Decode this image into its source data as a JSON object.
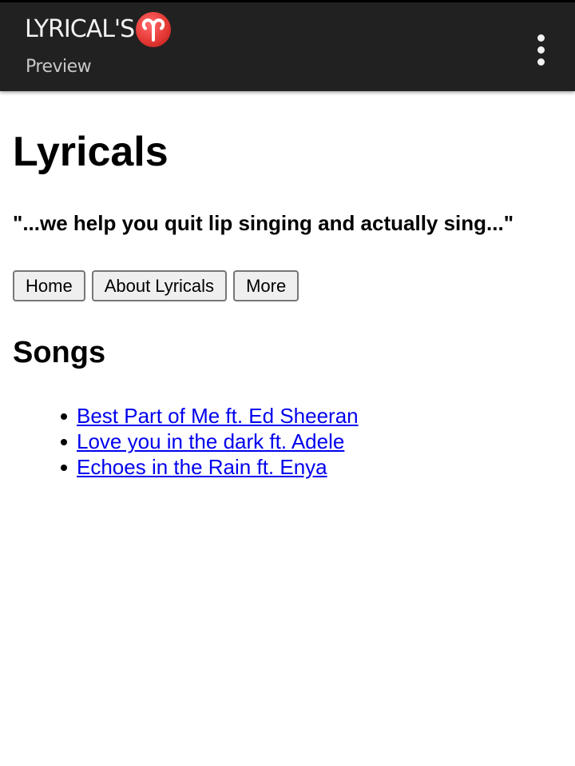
{
  "appbar": {
    "title": "LYRICAL'S",
    "title_icon": "aries-symbol-icon",
    "subtitle": "Preview",
    "menu_icon": "more-vert-icon",
    "background": "#212121",
    "badge_color": "#e53935"
  },
  "page": {
    "title": "Lyricals",
    "tagline": "\"...we help you quit lip singing and actually sing...\""
  },
  "nav": {
    "home": "Home",
    "about": "About Lyricals",
    "more": "More"
  },
  "songs": {
    "heading": "Songs",
    "link_color": "#0000ee",
    "items": [
      {
        "label": "Best Part of Me ft. Ed Sheeran"
      },
      {
        "label": "Love you in the dark ft. Adele"
      },
      {
        "label": "Echoes in the Rain ft. Enya"
      }
    ]
  }
}
